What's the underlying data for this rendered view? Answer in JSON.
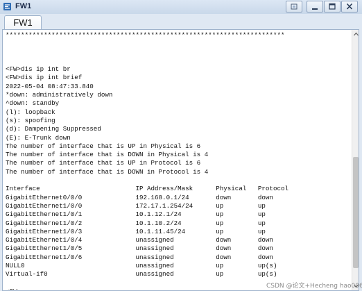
{
  "window": {
    "title": "FW1",
    "icon": "ensp-device-icon",
    "controls": [
      "restore-icon",
      "minimize-icon",
      "maximize-icon",
      "close-icon"
    ]
  },
  "tabs": [
    {
      "label": "FW1"
    }
  ],
  "terminal": {
    "lines": [
      "*************************************************************************",
      "",
      "",
      "",
      "<FW>dis ip int br",
      "<FW>dis ip int brief",
      "2022-05-04 08:47:33.840",
      "*down: administratively down",
      "^down: standby",
      "(l): loopback",
      "(s): spoofing",
      "(d): Dampening Suppressed",
      "(E): E-Trunk down",
      "The number of interface that is UP in Physical is 6",
      "The number of interface that is DOWN in Physical is 4",
      "The number of interface that is UP in Protocol is 6",
      "The number of interface that is DOWN in Protocol is 4",
      "",
      "Interface                         IP Address/Mask      Physical   Protocol",
      "GigabitEthernet0/0/0              192.168.0.1/24       down       down",
      "GigabitEthernet1/0/0              172.17.1.254/24      up         up",
      "GigabitEthernet1/0/1              10.1.12.1/24         up         up",
      "GigabitEthernet1/0/2              10.1.10.2/24         up         up",
      "GigabitEthernet1/0/3              10.1.11.45/24        up         up",
      "GigabitEthernet1/0/4              unassigned           down       down",
      "GigabitEthernet1/0/5              unassigned           down       down",
      "GigabitEthernet1/0/6              unassigned           down       down",
      "NULL0                             unassigned           up         up(s)",
      "Virtual-if0                       unassigned           up         up(s)",
      "",
      "<FW>"
    ]
  },
  "watermark": "CSDN @论文+Hecheng hao0060",
  "colors": {
    "titlebar": "#c9d8ea",
    "text": "#111111",
    "background": "#ffffff"
  }
}
